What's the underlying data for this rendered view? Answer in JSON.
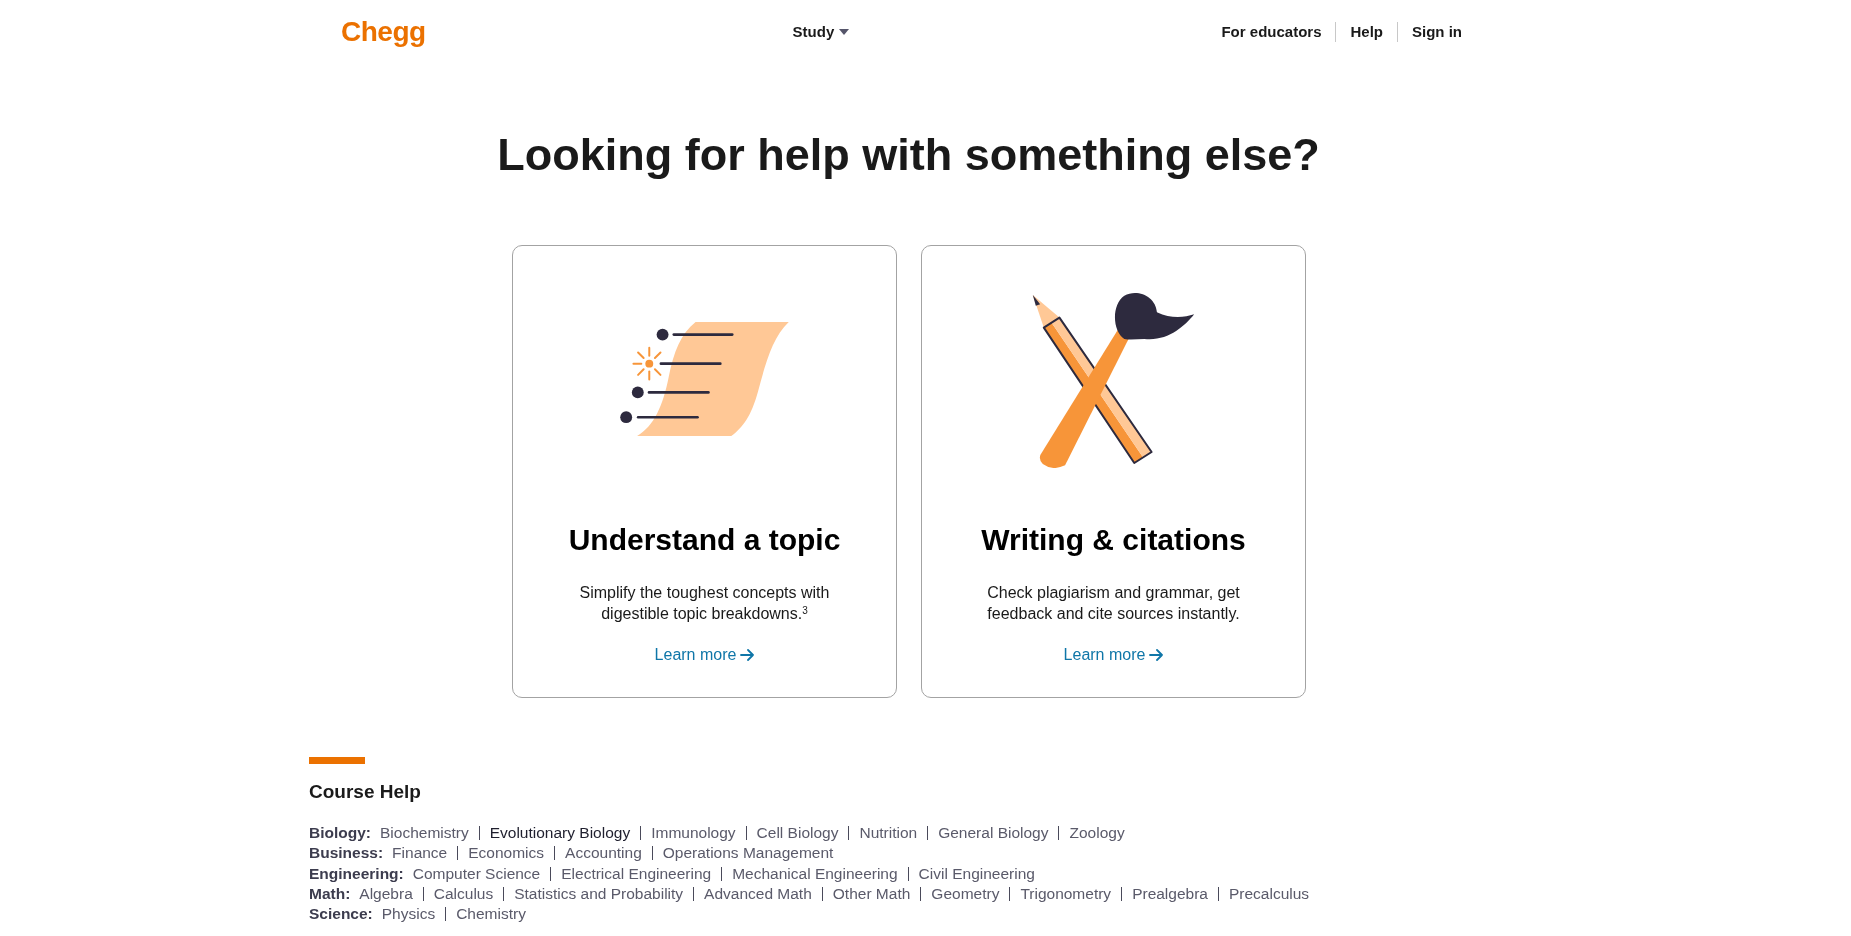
{
  "header": {
    "logo": "Chegg",
    "study_menu": "Study",
    "links": [
      "For educators",
      "Help",
      "Sign in"
    ]
  },
  "heading": "Looking for help with something else?",
  "cards": [
    {
      "kind": "topic",
      "title": "Understand a topic",
      "description": "Simplify the toughest concepts with digestible topic breakdowns.$^{3}$",
      "link": "Learn more"
    },
    {
      "kind": "writing",
      "title": "Writing & citations",
      "description": "Check plagiarism and grammar, get feedback and cite sources instantly.",
      "link": "Learn more"
    }
  ],
  "course_help": {
    "title": "Course Help",
    "categories": [
      {
        "label": "Biology:",
        "links": [
          {
            "text": "Biochemistry",
            "highlighted": false
          },
          {
            "text": "Evolutionary Biology",
            "highlighted": true
          },
          {
            "text": "Immunology",
            "highlighted": false
          },
          {
            "text": "Cell Biology",
            "highlighted": false
          },
          {
            "text": "Nutrition",
            "highlighted": false
          },
          {
            "text": "General Biology",
            "highlighted": false
          },
          {
            "text": "Zoology",
            "highlighted": false
          }
        ]
      },
      {
        "label": "Business:",
        "links": [
          {
            "text": "Finance",
            "highlighted": false
          },
          {
            "text": "Economics",
            "highlighted": false
          },
          {
            "text": "Accounting",
            "highlighted": false
          },
          {
            "text": "Operations Management",
            "highlighted": false
          }
        ]
      },
      {
        "label": "Engineering:",
        "links": [
          {
            "text": "Computer Science",
            "highlighted": false
          },
          {
            "text": "Electrical Engineering",
            "highlighted": false
          },
          {
            "text": "Mechanical Engineering",
            "highlighted": false
          },
          {
            "text": "Civil Engineering",
            "highlighted": false
          }
        ]
      },
      {
        "label": "Math:",
        "links": [
          {
            "text": "Algebra",
            "highlighted": false
          },
          {
            "text": "Calculus",
            "highlighted": false
          },
          {
            "text": "Statistics and Probability",
            "highlighted": false
          },
          {
            "text": "Advanced Math",
            "highlighted": false
          },
          {
            "text": "Other Math",
            "highlighted": false
          },
          {
            "text": "Geometry",
            "highlighted": false
          },
          {
            "text": "Trigonometry",
            "highlighted": false
          },
          {
            "text": "Prealgebra",
            "highlighted": false
          },
          {
            "text": "Precalculus",
            "highlighted": false
          }
        ]
      },
      {
        "label": "Science:",
        "links": [
          {
            "text": "Physics",
            "highlighted": false
          },
          {
            "text": "Chemistry",
            "highlighted": false
          }
        ]
      }
    ]
  }
}
